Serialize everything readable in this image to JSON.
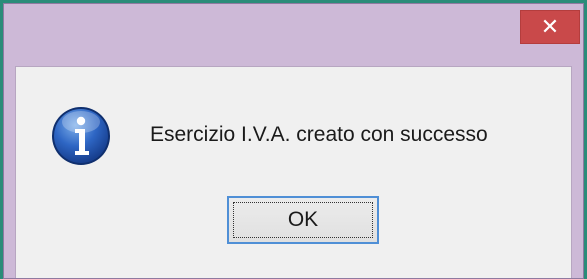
{
  "dialog": {
    "close_glyph": "✕",
    "message": "Esercizio I.V.A. creato con successo",
    "ok_label": "OK",
    "icon": "info-icon"
  },
  "colors": {
    "frame_accent": "#2a8c79",
    "titlebar": "#cdb9d7",
    "close_button": "#c9494a",
    "client_background": "#f0f0f0",
    "button_focus_border": "#4f8fd6"
  }
}
